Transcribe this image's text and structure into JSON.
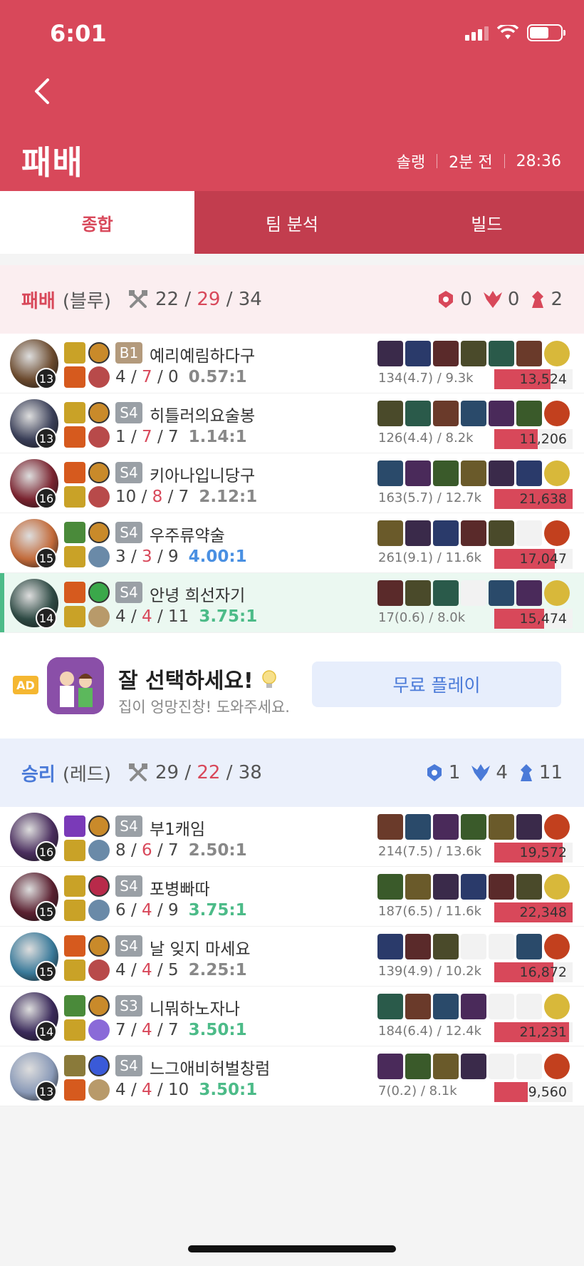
{
  "status": {
    "time": "6:01"
  },
  "header": {
    "title": "패배",
    "queue": "솔랭",
    "ago": "2분 전",
    "duration": "28:36"
  },
  "tabs": [
    "종합",
    "팀 분석",
    "빌드"
  ],
  "teams": [
    {
      "result": "패배",
      "side": "(블루)",
      "kills": "22",
      "deaths": "29",
      "assists": "34",
      "objectives": {
        "baron": "0",
        "dragon": "0",
        "tower": "2"
      }
    },
    {
      "result": "승리",
      "side": "(레드)",
      "kills": "29",
      "deaths": "22",
      "assists": "38",
      "objectives": {
        "baron": "1",
        "dragon": "4",
        "tower": "11"
      }
    }
  ],
  "players": [
    {
      "tier": "B1",
      "name": "예리예림하다구",
      "level": "13",
      "k": "4",
      "d": "7",
      "a": "0",
      "ratio": "0.57:1",
      "cs": "134(4.7) / 9.3k",
      "damage": "13,524",
      "damage_pct": 0.72
    },
    {
      "tier": "S4",
      "name": "히틀러의요술봉",
      "level": "13",
      "k": "1",
      "d": "7",
      "a": "7",
      "ratio": "1.14:1",
      "cs": "126(4.4) / 8.2k",
      "damage": "11,206",
      "damage_pct": 0.55
    },
    {
      "tier": "S4",
      "name": "키아나입니당구",
      "level": "16",
      "k": "10",
      "d": "8",
      "a": "7",
      "ratio": "2.12:1",
      "cs": "163(5.7) / 12.7k",
      "damage": "21,638",
      "damage_pct": 1.0
    },
    {
      "tier": "S4",
      "name": "우주류약술",
      "level": "15",
      "k": "3",
      "d": "3",
      "a": "9",
      "ratio": "4.00:1",
      "cs": "261(9.1) / 11.6k",
      "damage": "17,047",
      "damage_pct": 0.77
    },
    {
      "tier": "S4",
      "name": "안녕 희선자기",
      "level": "14",
      "k": "4",
      "d": "4",
      "a": "11",
      "ratio": "3.75:1",
      "cs": "17(0.6) / 8.0k",
      "damage": "15,474",
      "damage_pct": 0.64
    },
    {
      "tier": "S4",
      "name": "부1캐임",
      "level": "16",
      "k": "8",
      "d": "6",
      "a": "7",
      "ratio": "2.50:1",
      "cs": "214(7.5) / 13.6k",
      "damage": "19,572",
      "damage_pct": 0.87
    },
    {
      "tier": "S4",
      "name": "포병빠따",
      "level": "15",
      "k": "6",
      "d": "4",
      "a": "9",
      "ratio": "3.75:1",
      "cs": "187(6.5) / 11.6k",
      "damage": "22,348",
      "damage_pct": 1.0
    },
    {
      "tier": "S4",
      "name": "날 잊지 마세요",
      "level": "15",
      "k": "4",
      "d": "4",
      "a": "5",
      "ratio": "2.25:1",
      "cs": "139(4.9) / 10.2k",
      "damage": "16,872",
      "damage_pct": 0.75
    },
    {
      "tier": "S3",
      "name": "니뭐하노자나",
      "level": "14",
      "k": "7",
      "d": "4",
      "a": "7",
      "ratio": "3.50:1",
      "cs": "184(6.4) / 12.4k",
      "damage": "21,231",
      "damage_pct": 0.95
    },
    {
      "tier": "S4",
      "name": "느그애비허벌창럼",
      "level": "13",
      "k": "4",
      "d": "4",
      "a": "10",
      "ratio": "3.50:1",
      "cs": "7(0.2) / 8.1k",
      "damage": "9,560",
      "damage_pct": 0.43
    }
  ],
  "ad": {
    "badge": "AD",
    "title": "잘 선택하세요!",
    "subtitle": "집이 엉망진창! 도와주세요.",
    "button": "무료 플레이"
  },
  "colors": {
    "accent": "#d8485a",
    "win": "#4a7ad8",
    "good_kda": "#4cbb88"
  }
}
